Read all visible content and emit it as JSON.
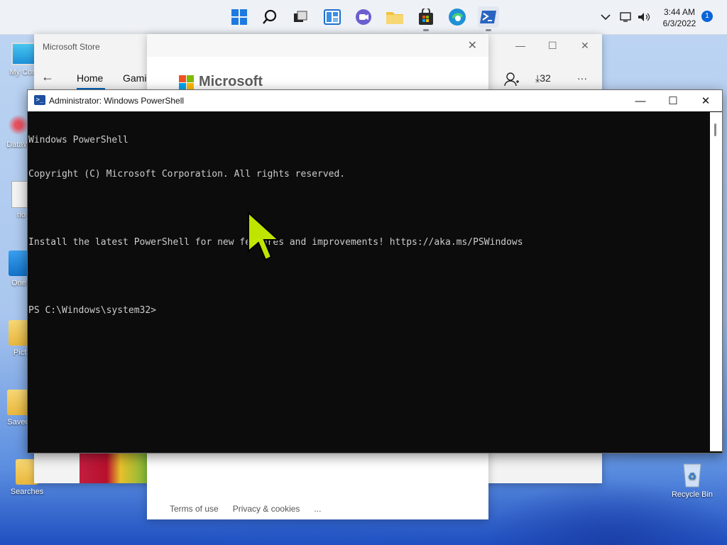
{
  "taskbar": {
    "apps": [
      {
        "name": "Start",
        "icon": "windows-start-icon"
      },
      {
        "name": "Search",
        "icon": "search-icon"
      },
      {
        "name": "Task View",
        "icon": "task-view-icon"
      },
      {
        "name": "Widgets",
        "icon": "widgets-icon"
      },
      {
        "name": "Chat",
        "icon": "chat-icon"
      },
      {
        "name": "File Explorer",
        "icon": "folder-icon"
      },
      {
        "name": "Microsoft Store",
        "icon": "store-icon"
      },
      {
        "name": "Microsoft Edge",
        "icon": "edge-icon"
      },
      {
        "name": "Windows PowerShell",
        "icon": "powershell-icon"
      }
    ],
    "time": "3:44 AM",
    "date": "6/3/2022",
    "notification_count": "1"
  },
  "desktop_icons": [
    {
      "label": "My Com",
      "icon": "monitor-icon"
    },
    {
      "label": "DataW",
      "icon": "datawrapper-icon"
    },
    {
      "label": "no",
      "icon": "notepad-file-icon"
    },
    {
      "label": "OneI",
      "icon": "onedrive-folder-icon"
    },
    {
      "label": "Pict",
      "icon": "folder-icon"
    },
    {
      "label": "Saved",
      "icon": "folder-icon"
    },
    {
      "label": "Searches",
      "icon": "folder-icon"
    }
  ],
  "recycle_bin": {
    "label": "Recycle Bin"
  },
  "store_window": {
    "title": "Microsoft Store",
    "nav_home": "Home",
    "nav_gaming": "Gami",
    "downloads_count": "32",
    "more": "···"
  },
  "ms_dialog": {
    "logo_text": "Microsoft",
    "footer": {
      "terms": "Terms of use",
      "privacy": "Privacy & cookies",
      "more": "..."
    }
  },
  "powershell": {
    "title": "Administrator: Windows PowerShell",
    "lines": [
      "Windows PowerShell",
      "Copyright (C) Microsoft Corporation. All rights reserved.",
      "",
      "Install the latest PowerShell for new features and improvements! https://aka.ms/PSWindows",
      "",
      "PS C:\\Windows\\system32>"
    ]
  },
  "colors": {
    "accent": "#0067c0",
    "console_bg": "#0c0c0c",
    "console_fg": "#cccccc",
    "cursor": "#c8f000"
  }
}
